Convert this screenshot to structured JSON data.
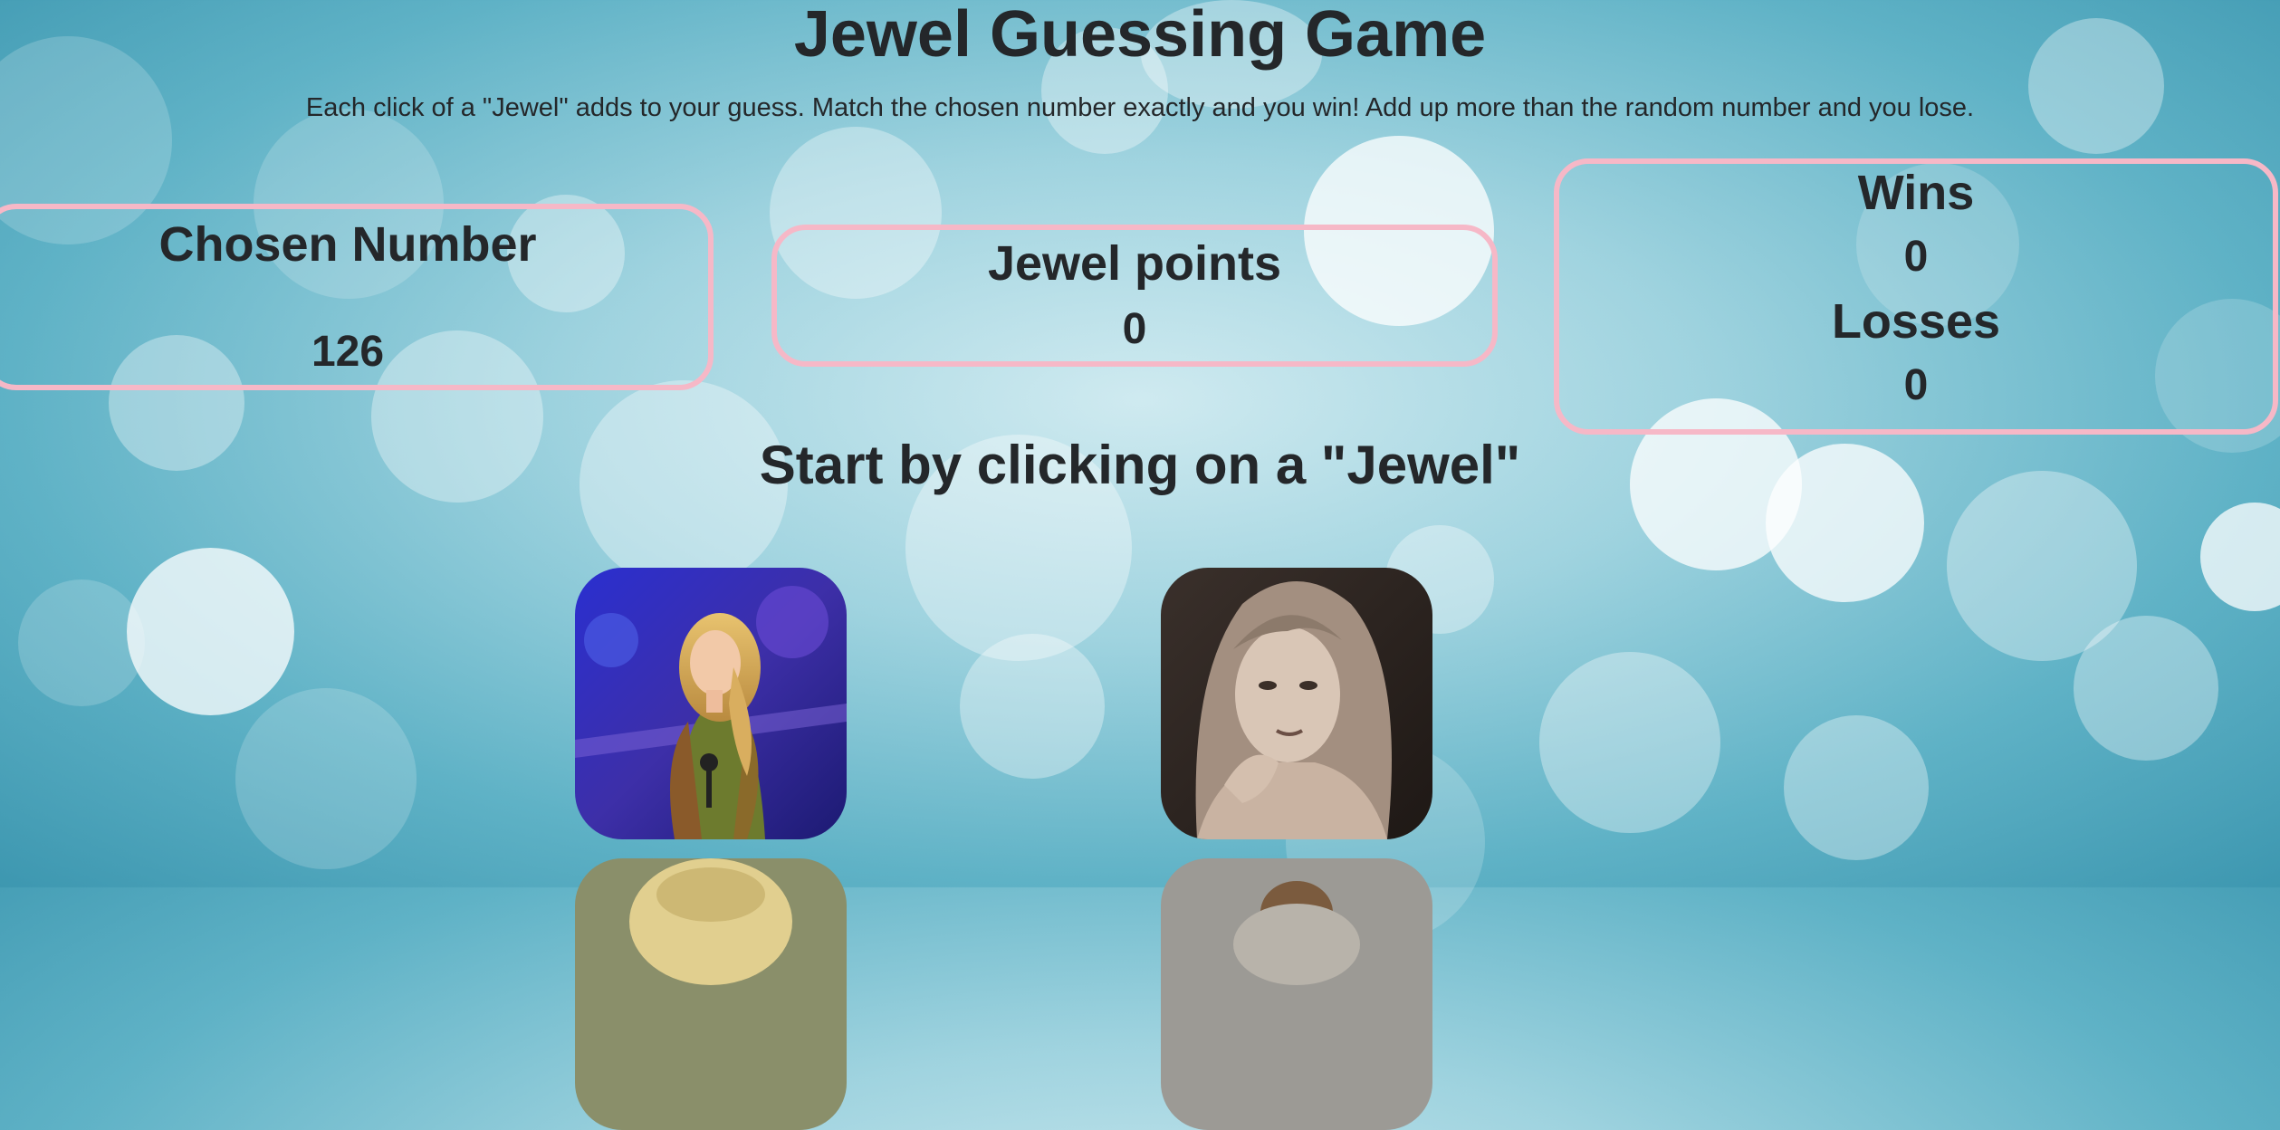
{
  "page": {
    "title": "Jewel Guessing Game",
    "instructions": "Each click of a \"Jewel\" adds to your guess. Match the chosen number exactly and you win! Add up more than the random number and you lose.",
    "prompt": "Start by clicking on a \"Jewel\""
  },
  "chosen": {
    "label": "Chosen Number",
    "value": "126"
  },
  "jewel_points": {
    "label": "Jewel points",
    "value": "0"
  },
  "score": {
    "wins_label": "Wins",
    "wins_value": "0",
    "losses_label": "Losses",
    "losses_value": "0"
  },
  "colors": {
    "panel_border": "#f6b8c7",
    "text": "#24272a",
    "background": "#5fb2c6"
  }
}
